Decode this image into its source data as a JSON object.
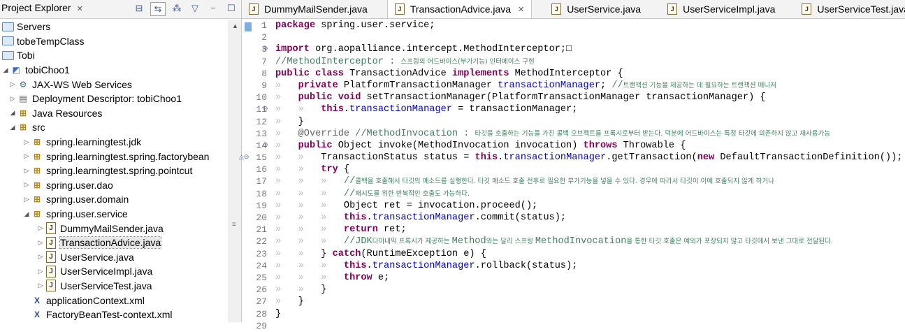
{
  "explorer": {
    "title": "Project Explorer",
    "tree": [
      {
        "label": "Servers",
        "icon": "folder-icon",
        "depth": 0,
        "twisty": ""
      },
      {
        "label": "tobeTempClass",
        "icon": "folder-icon",
        "depth": 0,
        "twisty": ""
      },
      {
        "label": "Tobi",
        "icon": "folder-icon",
        "depth": 0,
        "twisty": ""
      },
      {
        "label": "tobiChoo1",
        "icon": "project-icon",
        "depth": 0,
        "twisty": "open"
      },
      {
        "label": "JAX-WS Web Services",
        "icon": "webservices-icon",
        "depth": 1,
        "twisty": "closed"
      },
      {
        "label": "Deployment Descriptor: tobiChoo1",
        "icon": "descriptor-icon",
        "depth": 1,
        "twisty": "closed"
      },
      {
        "label": "Java Resources",
        "icon": "java-resources-icon",
        "depth": 1,
        "twisty": "open"
      },
      {
        "label": "src",
        "icon": "source-folder-icon",
        "depth": 2,
        "twisty": "open"
      },
      {
        "label": "spring.learningtest.jdk",
        "icon": "package-icon",
        "depth": 3,
        "twisty": "closed"
      },
      {
        "label": "spring.learningtest.spring.factorybean",
        "icon": "package-icon",
        "depth": 3,
        "twisty": "closed"
      },
      {
        "label": "spring.learningtest.spring.pointcut",
        "icon": "package-icon",
        "depth": 3,
        "twisty": "closed"
      },
      {
        "label": "spring.user.dao",
        "icon": "package-icon",
        "depth": 3,
        "twisty": "closed"
      },
      {
        "label": "spring.user.domain",
        "icon": "package-icon",
        "depth": 3,
        "twisty": "closed"
      },
      {
        "label": "spring.user.service",
        "icon": "package-icon",
        "depth": 3,
        "twisty": "open"
      },
      {
        "label": "DummyMailSender.java",
        "icon": "java-file-icon",
        "depth": 4,
        "twisty": "closed"
      },
      {
        "label": "TransactionAdvice.java",
        "icon": "java-file-icon",
        "depth": 4,
        "twisty": "closed",
        "selected": true
      },
      {
        "label": "UserService.java",
        "icon": "java-file-icon",
        "depth": 4,
        "twisty": "closed"
      },
      {
        "label": "UserServiceImpl.java",
        "icon": "java-file-icon",
        "depth": 4,
        "twisty": "closed"
      },
      {
        "label": "UserServiceTest.java",
        "icon": "java-file-icon",
        "depth": 4,
        "twisty": "closed"
      },
      {
        "label": "applicationContext.xml",
        "icon": "xml-file-icon",
        "depth": 3,
        "twisty": ""
      },
      {
        "label": "FactoryBeanTest-context.xml",
        "icon": "xml-file-icon",
        "depth": 3,
        "twisty": ""
      }
    ]
  },
  "editor": {
    "tabs": [
      {
        "label": "DummyMailSender.java",
        "active": false
      },
      {
        "label": "TransactionAdvice.java",
        "active": true
      },
      {
        "label": "UserService.java",
        "active": false
      },
      {
        "label": "UserServiceImpl.java",
        "active": false
      },
      {
        "label": "UserServiceTest.java",
        "active": false
      }
    ],
    "line_numbers": [
      "1",
      "2",
      "3",
      "7",
      "8",
      "9",
      "10",
      "11",
      "12",
      "13",
      "14",
      "15",
      "16",
      "17",
      "18",
      "19",
      "20",
      "21",
      "22",
      "23",
      "24",
      "25",
      "26",
      "27",
      "28",
      "29"
    ],
    "fold_markers": {
      "3": "⊕",
      "11": "⊖",
      "14": "⊖",
      "15": "△⊖"
    },
    "lines": [
      [
        [
          "kw",
          "package"
        ],
        [
          "t",
          " spring.user.service;"
        ]
      ],
      [],
      [
        [
          "kw",
          "import"
        ],
        [
          "t",
          " org.aopalliance.intercept.MethodInterceptor;"
        ],
        [
          "t",
          "□"
        ]
      ],
      [
        [
          "cm",
          "//MethodInterceptor : "
        ],
        [
          "cmk",
          "스프링의 어드바이스(부가기능) 인터페이스 구현"
        ]
      ],
      [
        [
          "kw",
          "public class"
        ],
        [
          "t",
          " TransactionAdvice "
        ],
        [
          "kw",
          "implements"
        ],
        [
          "t",
          " MethodInterceptor {"
        ]
      ],
      [
        [
          "gd",
          "»   "
        ],
        [
          "kw",
          "private"
        ],
        [
          "t",
          " PlatformTransactionManager "
        ],
        [
          "fld",
          "transactionManager"
        ],
        [
          "t",
          "; "
        ],
        [
          "cm",
          "//"
        ],
        [
          "cmk",
          "트랜잭션 기능을 제공하는 데 필요하는 트랜잭션 매니저"
        ]
      ],
      [
        [
          "gd",
          "»   "
        ],
        [
          "kw",
          "public void"
        ],
        [
          "t",
          " setTransactionManager(PlatformTransactionManager transactionManager) {"
        ]
      ],
      [
        [
          "gd",
          "»   »   "
        ],
        [
          "kw",
          "this"
        ],
        [
          "t",
          "."
        ],
        [
          "fld",
          "transactionManager"
        ],
        [
          "t",
          " = transactionManager;"
        ]
      ],
      [
        [
          "gd",
          "»   "
        ],
        [
          "t",
          "}"
        ]
      ],
      [
        [
          "gd",
          "»   "
        ],
        [
          "ann",
          "@Override"
        ],
        [
          "t",
          " "
        ],
        [
          "cm",
          "//MethodInvocation : "
        ],
        [
          "cmk",
          "타깃을 호출하는 기능을 가진 콜백 오브젝트를 프록시로부터 받는다. 덕분에 어드바이스는 특정 타깃에 의존하지 않고 재사용가능"
        ]
      ],
      [
        [
          "gd",
          "»   "
        ],
        [
          "kw",
          "public"
        ],
        [
          "t",
          " Object invoke(MethodInvocation invocation) "
        ],
        [
          "kw",
          "throws"
        ],
        [
          "t",
          " Throwable {"
        ]
      ],
      [
        [
          "gd",
          "»   »   "
        ],
        [
          "t",
          "TransactionStatus status = "
        ],
        [
          "kw",
          "this"
        ],
        [
          "t",
          "."
        ],
        [
          "fld",
          "transactionManager"
        ],
        [
          "t",
          ".getTransaction("
        ],
        [
          "kw",
          "new"
        ],
        [
          "t",
          " DefaultTransactionDefinition());"
        ]
      ],
      [
        [
          "gd",
          "»   »   "
        ],
        [
          "kw",
          "try"
        ],
        [
          "t",
          " {"
        ]
      ],
      [
        [
          "gd",
          "»   »   »   "
        ],
        [
          "cm",
          "//"
        ],
        [
          "cmk",
          "콜백을 호출해서 타깃의 메소드를 실행한다. 타깃 메소드 호출 전후로 필요한 부가기능을 넣을 수 있다. 경우에 따라서 타깃이 아예 호출되지 않게 하거나"
        ]
      ],
      [
        [
          "gd",
          "»   »   »   "
        ],
        [
          "cm",
          "//"
        ],
        [
          "cmk",
          "재시도를 위한 반복적인 호출도 가능하다."
        ]
      ],
      [
        [
          "gd",
          "»   »   »   "
        ],
        [
          "t",
          "Object ret = invocation.proceed();"
        ]
      ],
      [
        [
          "gd",
          "»   »   »   "
        ],
        [
          "kw",
          "this"
        ],
        [
          "t",
          "."
        ],
        [
          "fld",
          "transactionManager"
        ],
        [
          "t",
          ".commit(status);"
        ]
      ],
      [
        [
          "gd",
          "»   »   »   "
        ],
        [
          "kw",
          "return"
        ],
        [
          "t",
          " ret;"
        ]
      ],
      [
        [
          "gd",
          "»   »   »   "
        ],
        [
          "cm",
          "//JDK"
        ],
        [
          "cmk",
          "다이내믹 프록시가 제공하는 "
        ],
        [
          "cm",
          "Method"
        ],
        [
          "cmk",
          "와는 달리 스프링 "
        ],
        [
          "cm",
          "MethodInvocation"
        ],
        [
          "cmk",
          "을 통한 타깃 호출은 예외가 포장되지 않고 타깃에서 보낸 그대로 전달된다."
        ]
      ],
      [
        [
          "gd",
          "»   »   "
        ],
        [
          "t",
          "} "
        ],
        [
          "kw",
          "catch"
        ],
        [
          "t",
          "(RuntimeException e) {"
        ]
      ],
      [
        [
          "gd",
          "»   »   »   "
        ],
        [
          "kw",
          "this"
        ],
        [
          "t",
          "."
        ],
        [
          "fld",
          "transactionManager"
        ],
        [
          "t",
          ".rollback(status);"
        ]
      ],
      [
        [
          "gd",
          "»   »   »   "
        ],
        [
          "kw",
          "throw"
        ],
        [
          "t",
          " e;"
        ]
      ],
      [
        [
          "gd",
          "»   »   "
        ],
        [
          "t",
          "}"
        ]
      ],
      [
        [
          "gd",
          "»   "
        ],
        [
          "t",
          "}"
        ]
      ],
      [
        [
          "t",
          "}"
        ]
      ],
      []
    ]
  }
}
